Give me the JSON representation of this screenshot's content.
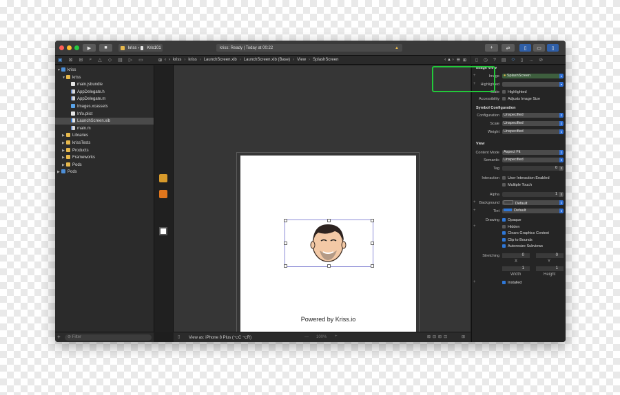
{
  "toolbar": {
    "scheme_project": "kriss",
    "scheme_device": "Kris101",
    "status_text": "kriss: Ready | Today at 00:22",
    "warning_glyph": "▲"
  },
  "navigator": {
    "items": [
      {
        "label": "kriss",
        "indent": 0,
        "icon": "blue-project",
        "disclosure": "▼"
      },
      {
        "label": "kriss",
        "indent": 1,
        "icon": "folder",
        "disclosure": "▼"
      },
      {
        "label": "main.jsbundle",
        "indent": 2,
        "icon": "file"
      },
      {
        "label": "AppDelegate.h",
        "indent": 2,
        "icon": "hfile"
      },
      {
        "label": "AppDelegate.m",
        "indent": 2,
        "icon": "hfile"
      },
      {
        "label": "Images.xcassets",
        "indent": 2,
        "icon": "asset"
      },
      {
        "label": "Info.plist",
        "indent": 2,
        "icon": "file"
      },
      {
        "label": "LaunchScreen.xib",
        "indent": 2,
        "icon": "xib",
        "selected": true
      },
      {
        "label": "main.m",
        "indent": 2,
        "icon": "hfile"
      },
      {
        "label": "Libraries",
        "indent": 1,
        "icon": "folder",
        "disclosure": "▶"
      },
      {
        "label": "krissTests",
        "indent": 1,
        "icon": "folder",
        "disclosure": "▶"
      },
      {
        "label": "Products",
        "indent": 1,
        "icon": "folder",
        "disclosure": "▶"
      },
      {
        "label": "Frameworks",
        "indent": 1,
        "icon": "folder",
        "disclosure": "▶"
      },
      {
        "label": "Pods",
        "indent": 1,
        "icon": "folder",
        "disclosure": "▶"
      },
      {
        "label": "Pods",
        "indent": 0,
        "icon": "blue-project",
        "disclosure": "▶"
      }
    ],
    "filter_placeholder": "Filter"
  },
  "jumpbar": {
    "crumbs": [
      "kriss",
      "kriss",
      "LaunchScreen.xib",
      "LaunchScreen.xib (Base)",
      "View",
      "SplashScreen"
    ]
  },
  "canvas": {
    "powered_text": "Powered by Kriss.io",
    "view_as": "View as: iPhone 8 Plus (⌥C ⌥R)",
    "zoom": "100%"
  },
  "inspector": {
    "section_image_view": "Image View",
    "image_label": "Image",
    "image_value": "SplashScreen",
    "highlighted_label": "Highlighted",
    "state_label": "State",
    "state_value": "Highlighted",
    "accessibility_label": "Accessibility",
    "accessibility_value": "Adjusts Image Size",
    "section_symbol": "Symbol Configuration",
    "configuration_label": "Configuration",
    "configuration_value": "Unspecified",
    "scale_label": "Scale",
    "scale_value": "Unspecified",
    "weight_label": "Weight",
    "weight_value": "Unspecified",
    "section_view": "View",
    "content_mode_label": "Content Mode",
    "content_mode_value": "Aspect Fit",
    "semantic_label": "Semantic",
    "semantic_value": "Unspecified",
    "tag_label": "Tag",
    "tag_value": "0",
    "interaction_label": "Interaction",
    "user_interaction": "User Interaction Enabled",
    "multiple_touch": "Multiple Touch",
    "alpha_label": "Alpha",
    "alpha_value": "1",
    "background_label": "Background",
    "background_value": "Default",
    "tint_label": "Tint",
    "tint_value": "Default",
    "drawing_label": "Drawing",
    "opaque": "Opaque",
    "hidden": "Hidden",
    "clears_graphics": "Clears Graphics Context",
    "clip_bounds": "Clip to Bounds",
    "autoresize": "Autoresize Subviews",
    "stretching_label": "Stretching",
    "stretch_x": "0",
    "stretch_y": "0",
    "x_label": "X",
    "y_label": "Y",
    "stretch_w": "1",
    "stretch_h": "1",
    "width_label": "Width",
    "height_label": "Height",
    "installed": "Installed"
  },
  "colors": {
    "highlight_ring": "#22c93a",
    "accent": "#2f78d8"
  }
}
